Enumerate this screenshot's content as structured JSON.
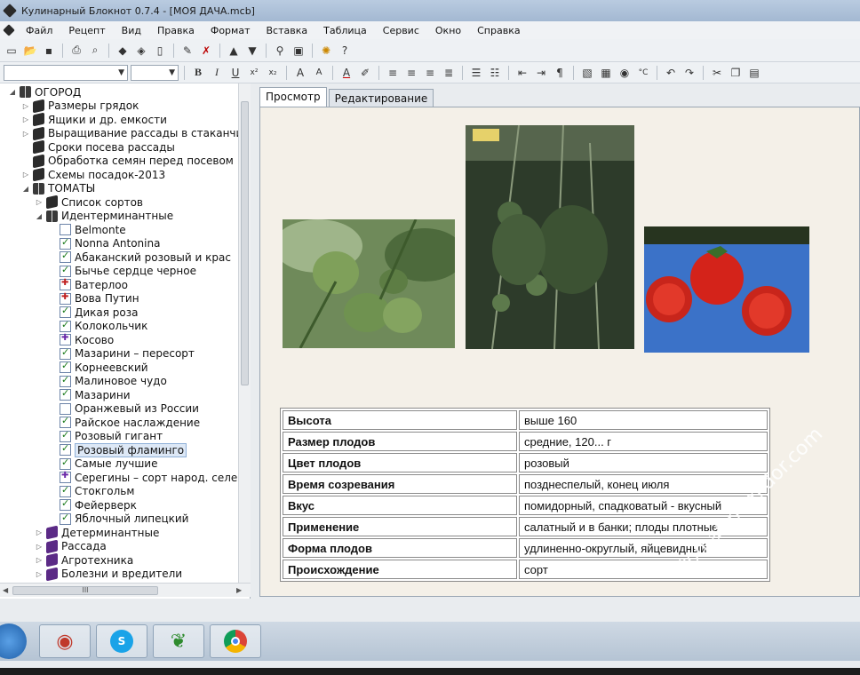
{
  "window": {
    "title": "Кулинарный Блокнот 0.7.4 - [МОЯ ДАЧА.mcb]"
  },
  "menu": [
    "Файл",
    "Рецепт",
    "Вид",
    "Правка",
    "Формат",
    "Вставка",
    "Таблица",
    "Сервис",
    "Окно",
    "Справка"
  ],
  "tree": {
    "items": [
      {
        "label": "ОГОРОД",
        "level": 0,
        "icon": "open-book-icon"
      },
      {
        "label": "Размеры грядок",
        "level": 1,
        "icon": "book-icon"
      },
      {
        "label": "Ящики и др. емкости",
        "level": 1,
        "icon": "book-icon"
      },
      {
        "label": "Выращивание рассады в стаканчи",
        "level": 1,
        "icon": "book-icon"
      },
      {
        "label": "Сроки посева рассады",
        "level": 1,
        "icon": "book-icon"
      },
      {
        "label": "Обработка семян перед посевом",
        "level": 1,
        "icon": "book-icon"
      },
      {
        "label": "Схемы посадок-2013",
        "level": 1,
        "icon": "book-icon"
      },
      {
        "label": "ТОМАТЫ",
        "level": 1,
        "icon": "open-book-icon"
      },
      {
        "label": "Список сортов",
        "level": 2,
        "icon": "book-icon"
      },
      {
        "label": "Идентерминантные",
        "level": 2,
        "icon": "open-book-icon"
      },
      {
        "label": "Belmonte",
        "level": 3,
        "icon": "document-icon"
      },
      {
        "label": "Nonna Antonina",
        "level": 3,
        "icon": "checked-document-icon"
      },
      {
        "label": "Абаканский розовый и крас",
        "level": 3,
        "icon": "checked-document-icon"
      },
      {
        "label": "Бычье сердце черное",
        "level": 3,
        "icon": "checked-document-icon"
      },
      {
        "label": "Ватерлоо",
        "level": 3,
        "icon": "red-cross-document-icon"
      },
      {
        "label": "Вова Путин",
        "level": 3,
        "icon": "red-cross-document-icon"
      },
      {
        "label": "Дикая роза",
        "level": 3,
        "icon": "checked-document-icon"
      },
      {
        "label": "Колокольчик",
        "level": 3,
        "icon": "checked-document-icon"
      },
      {
        "label": "Косово",
        "level": 3,
        "icon": "purple-cross-document-icon"
      },
      {
        "label": "Мазарини – пересорт",
        "level": 3,
        "icon": "checked-document-icon"
      },
      {
        "label": "Корнеевский",
        "level": 3,
        "icon": "checked-document-icon"
      },
      {
        "label": "Малиновое чудо",
        "level": 3,
        "icon": "checked-document-icon"
      },
      {
        "label": "Мазарини",
        "level": 3,
        "icon": "checked-document-icon"
      },
      {
        "label": "Оранжевый из России",
        "level": 3,
        "icon": "document-icon"
      },
      {
        "label": "Райское наслаждение",
        "level": 3,
        "icon": "checked-document-icon"
      },
      {
        "label": "Розовый гигант",
        "level": 3,
        "icon": "checked-document-icon"
      },
      {
        "label": "Розовый фламинго",
        "level": 3,
        "icon": "checked-document-icon",
        "selected": true
      },
      {
        "label": "Самые лучшие",
        "level": 3,
        "icon": "checked-document-icon"
      },
      {
        "label": "Серегины – сорт народ. селе",
        "level": 3,
        "icon": "purple-cross-document-icon"
      },
      {
        "label": "Стокгольм",
        "level": 3,
        "icon": "checked-document-icon"
      },
      {
        "label": "Фейерверк",
        "level": 3,
        "icon": "checked-document-icon"
      },
      {
        "label": "Яблочный липецкий",
        "level": 3,
        "icon": "checked-document-icon"
      },
      {
        "label": "Детерминантные",
        "level": 2,
        "icon": "purple-book-icon"
      },
      {
        "label": "Рассада",
        "level": 2,
        "icon": "purple-book-icon"
      },
      {
        "label": "Агротехника",
        "level": 2,
        "icon": "purple-book-icon"
      },
      {
        "label": "Болезни и вредители",
        "level": 2,
        "icon": "purple-book-icon"
      }
    ],
    "hscroll_label": "III"
  },
  "tabs": [
    "Просмотр",
    "Редактирование"
  ],
  "properties": [
    {
      "key": "Высота",
      "value": "выше 160"
    },
    {
      "key": "Размер плодов",
      "value": "средние,  120... г"
    },
    {
      "key": "Цвет плодов",
      "value": "розовый"
    },
    {
      "key": "Время созревания",
      "value": "позднеспелый, конец июля"
    },
    {
      "key": "Вкус",
      "value": "помидорный, спадковатый - вкусный"
    },
    {
      "key": "Применение",
      "value": "салатный и в банки; плоды плотные"
    },
    {
      "key": "Форма плодов",
      "value": "удлиненно-округлый, яйцевидный"
    },
    {
      "key": "Происхождение",
      "value": "сорт"
    }
  ],
  "watermark": "tomat-pomidor.com",
  "taskbar": {
    "apps": [
      "eye-app-icon",
      "skype-icon",
      "lettuce-app-icon",
      "chrome-icon"
    ]
  },
  "colors": {
    "selection": "#dde8f6",
    "content_bg": "#f4f0e8",
    "tomato_red": "#d4231a"
  }
}
